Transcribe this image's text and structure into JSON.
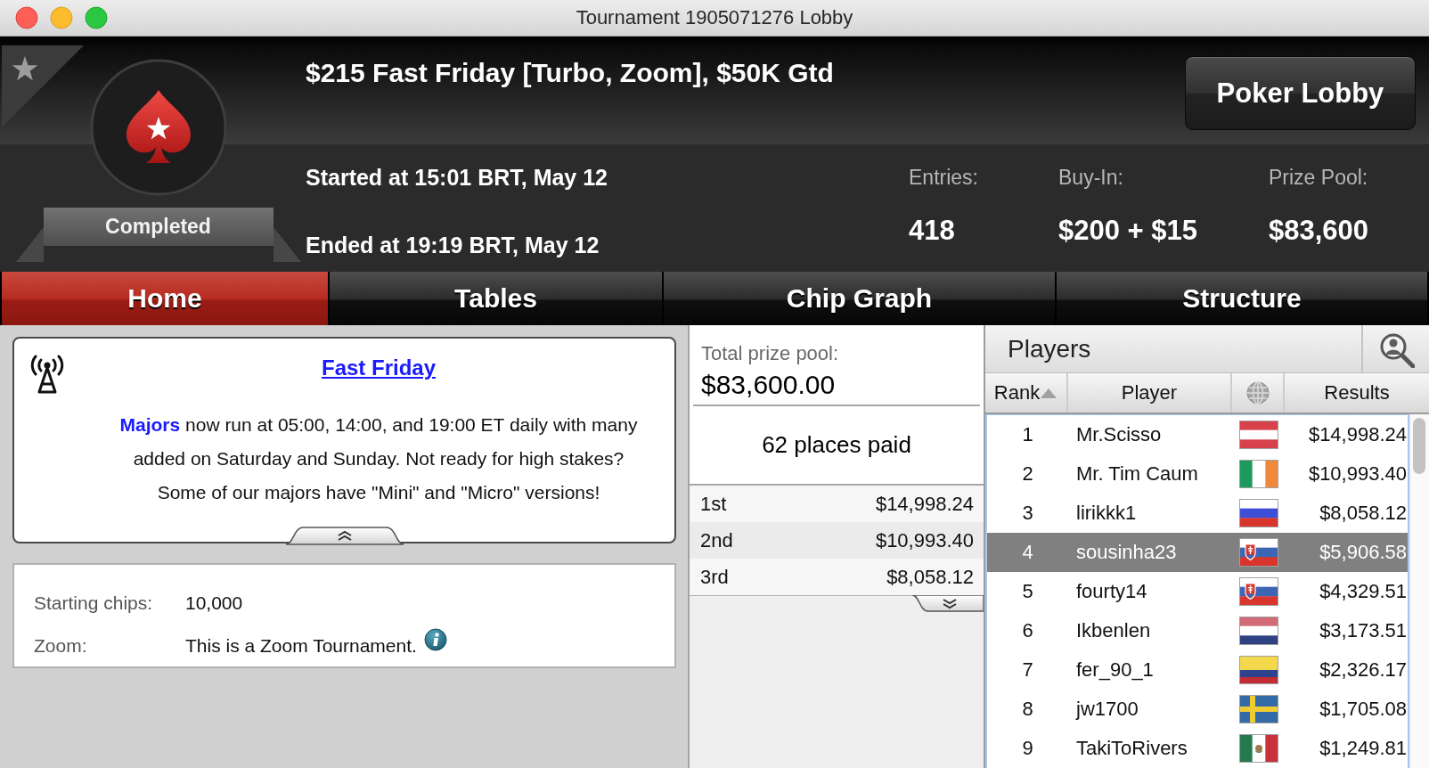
{
  "window": {
    "title": "Tournament 1905071276 Lobby"
  },
  "tournament": {
    "title": "$215 Fast Friday [Turbo, Zoom], $50K Gtd",
    "status": "Completed",
    "started": "Started at 15:01 BRT, May 12",
    "ended": "Ended at 19:19 BRT, May 12",
    "stats": [
      {
        "label": "Entries:",
        "value": "418"
      },
      {
        "label": "Buy-In:",
        "value": "$200 + $15"
      },
      {
        "label": "Prize Pool:",
        "value": "$83,600"
      }
    ]
  },
  "lobby_button": "Poker Lobby",
  "tabs": [
    {
      "label": "Home",
      "selected": true
    },
    {
      "label": "Tables",
      "selected": false
    },
    {
      "label": "Chip Graph",
      "selected": false
    },
    {
      "label": "Structure",
      "selected": false
    }
  ],
  "announcement": {
    "title": "Fast Friday",
    "link": "Majors",
    "text": "now run at 05:00, 14:00, and 19:00 ET daily with many added on Saturday and Sunday. Not ready for high stakes? Some of our majors have \"Mini\" and \"Micro\" versions!"
  },
  "details": [
    {
      "label": "Starting chips:",
      "value": "10,000",
      "info_icon": false
    },
    {
      "label": "Zoom:",
      "value": "This is a Zoom Tournament.",
      "info_icon": true
    }
  ],
  "prize_pool": {
    "label": "Total prize pool:",
    "amount": "$83,600.00",
    "places_paid": "62 places paid",
    "payouts": [
      {
        "place": "1st",
        "amount": "$14,998.24"
      },
      {
        "place": "2nd",
        "amount": "$10,993.40"
      },
      {
        "place": "3rd",
        "amount": "$8,058.12"
      }
    ]
  },
  "players": {
    "title": "Players",
    "columns": [
      {
        "kind": "text",
        "label": "Rank",
        "sorted": true
      },
      {
        "kind": "text",
        "label": "Player",
        "sorted": false
      },
      {
        "kind": "globe",
        "sorted": false
      },
      {
        "kind": "text",
        "label": "Results",
        "sorted": false
      }
    ],
    "rows": [
      {
        "rank": "1",
        "player": "Mr.Scisso",
        "flag": {
          "kind": "austria"
        },
        "results": "$14,998.24",
        "selected": false
      },
      {
        "rank": "2",
        "player": "Mr. Tim Caum",
        "flag": {
          "kind": "ireland"
        },
        "results": "$10,993.40",
        "selected": false
      },
      {
        "rank": "3",
        "player": "lirikkk1",
        "flag": {
          "kind": "russia"
        },
        "results": "$8,058.12",
        "selected": false
      },
      {
        "rank": "4",
        "player": "sousinha23",
        "flag": {
          "kind": "slovakia"
        },
        "results": "$5,906.58",
        "selected": true
      },
      {
        "rank": "5",
        "player": "fourty14",
        "flag": {
          "kind": "slovakia"
        },
        "results": "$4,329.51",
        "selected": false
      },
      {
        "rank": "6",
        "player": "Ikbenlen",
        "flag": {
          "kind": "netherlands"
        },
        "results": "$3,173.51",
        "selected": false
      },
      {
        "rank": "7",
        "player": "fer_90_1",
        "flag": {
          "kind": "colombia"
        },
        "results": "$2,326.17",
        "selected": false
      },
      {
        "rank": "8",
        "player": "jw1700",
        "flag": {
          "kind": "sweden"
        },
        "results": "$1,705.08",
        "selected": false
      },
      {
        "rank": "9",
        "player": "TakiToRivers",
        "flag": {
          "kind": "mexico"
        },
        "results": "$1,249.81",
        "selected": false
      }
    ]
  }
}
